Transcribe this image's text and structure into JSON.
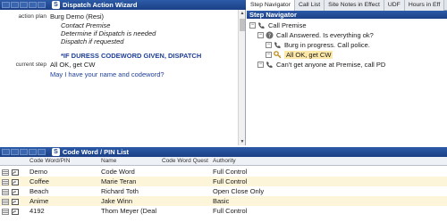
{
  "dispatch": {
    "title": "Dispatch Action Wizard",
    "action_plan_label": "action plan",
    "action_plan_value": "Burg Demo (Resi)",
    "lines": [
      "Contact Premise",
      "Determine if Dispatch is needed",
      "Dispatch if requested"
    ],
    "duress": "*IF DURESS CODEWORD GIVEN, DISPATCH",
    "current_step_label": "current step",
    "current_step_value": "All OK, get CW",
    "question": "May I have your name and codeword?"
  },
  "tabs": [
    "Step Navigator",
    "Call List",
    "Site Notes in Effect",
    "UDF",
    "Hours in Eff"
  ],
  "step_navigator": {
    "title": "Step Navigator",
    "items": [
      "Call Premise",
      "Call Answered.  Is everything ok?",
      "Burg in progress.  Call police.",
      "All OK, get CW",
      "Can't get anyone at Premise, call PD"
    ]
  },
  "code_list": {
    "title": "Code Word / PIN List",
    "columns": [
      "Code Word/PIN",
      "Name",
      "Code Word Quest",
      "Authority"
    ],
    "rows": [
      [
        "Demo",
        "Code Word",
        "",
        "Full Control"
      ],
      [
        "Coffee",
        "Marie Teran",
        "",
        "Full Control"
      ],
      [
        "Beach",
        "Richard Toth",
        "",
        "Open Close Only"
      ],
      [
        "Anime",
        "Jake Winn",
        "",
        "Basic"
      ],
      [
        "4192",
        "Thom Meyer (Deal",
        "",
        "Full Control"
      ]
    ]
  },
  "colors": {
    "title_bar": "#1b3f85",
    "selected_step": "#fde9a7",
    "alt_row": "#fdf5da",
    "question_text": "#1f3f9a"
  }
}
